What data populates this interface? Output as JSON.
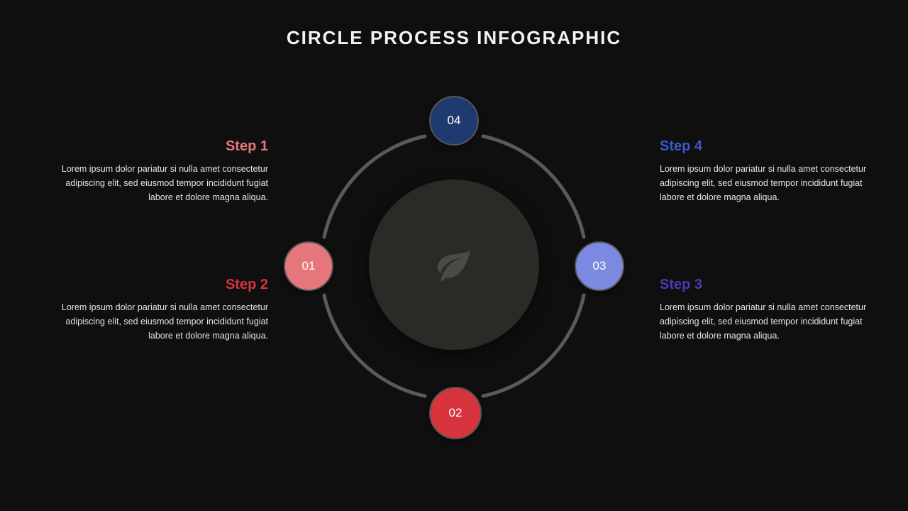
{
  "title": "CIRCLE PROCESS INFOGRAPHIC",
  "nodes": {
    "top": {
      "num": "04",
      "color": "#1f3a6e"
    },
    "right": {
      "num": "03",
      "color": "#7b8ae0"
    },
    "bottom": {
      "num": "02",
      "color": "#d8343d"
    },
    "left": {
      "num": "01",
      "color": "#e5777c"
    }
  },
  "center_icon": "leaf-icon",
  "steps": {
    "s1": {
      "heading": "Step 1",
      "body": "Lorem ipsum dolor pariatur si nulla amet consectetur adipiscing elit, sed eiusmod tempor incididunt fugiat labore et dolore magna aliqua.",
      "color": "#e5777c"
    },
    "s2": {
      "heading": "Step 2",
      "body": "Lorem ipsum dolor pariatur si nulla amet consectetur adipiscing elit, sed eiusmod tempor incididunt fugiat labore et dolore magna aliqua.",
      "color": "#d8343d"
    },
    "s3": {
      "heading": "Step 3",
      "body": "Lorem ipsum dolor pariatur si nulla amet consectetur adipiscing elit, sed eiusmod tempor incididunt fugiat labore et dolore magna aliqua.",
      "color": "#4a3ab8"
    },
    "s4": {
      "heading": "Step 4",
      "body": "Lorem ipsum dolor pariatur si nulla amet consectetur adipiscing elit, sed eiusmod tempor incididunt fugiat labore et dolore magna aliqua.",
      "color": "#3b5bc8"
    }
  }
}
